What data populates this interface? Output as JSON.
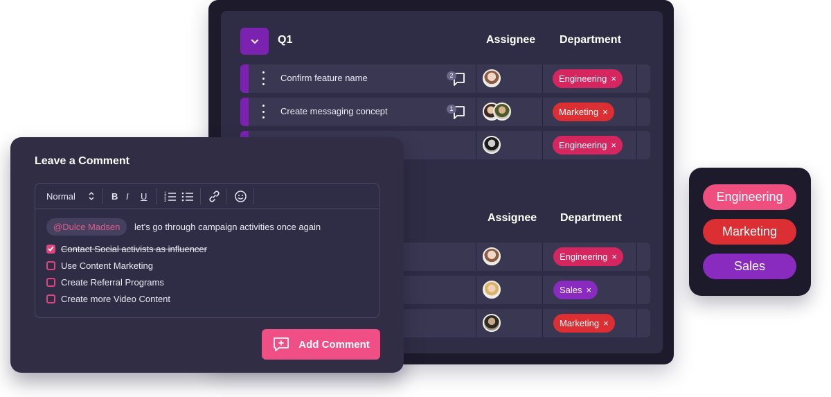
{
  "board": {
    "group1": {
      "title": "Q1",
      "assignee_label": "Assignee",
      "department_label": "Department",
      "rows": [
        {
          "task": "Confirm feature name",
          "comments": "2",
          "tag": "Engineering",
          "tag_close": "×"
        },
        {
          "task": "Create messaging concept",
          "comments": "1",
          "tag": "Marketing",
          "tag_close": "×"
        },
        {
          "task": "",
          "comments": "",
          "tag": "Engineering",
          "tag_close": "×"
        }
      ]
    },
    "group2": {
      "assignee_label": "Assignee",
      "department_label": "Department",
      "rows": [
        {
          "tag": "Engineering",
          "tag_close": "×"
        },
        {
          "tag": "Sales",
          "tag_close": "×"
        },
        {
          "tag": "Marketing",
          "tag_close": "×"
        }
      ]
    }
  },
  "comment": {
    "title": "Leave a Comment",
    "toolbar": {
      "style": "Normal",
      "bold": "B",
      "italic": "I",
      "underline": "U"
    },
    "mention": "@Dulce Madsen",
    "message": "let's go through campaign activities once again",
    "checklist": [
      {
        "label": "Contact Social activists as influencer",
        "checked": true
      },
      {
        "label": "Use Content Marketing",
        "checked": false
      },
      {
        "label": "Create Referral Programs",
        "checked": false
      },
      {
        "label": "Create more Video Content",
        "checked": false
      }
    ],
    "submit_label": "Add Comment"
  },
  "palette": {
    "options": [
      "Engineering",
      "Marketing",
      "Sales"
    ]
  },
  "colors": {
    "engineering": "#d6265f",
    "marketing": "#db2f33",
    "sales": "#8a2bbf",
    "accent_purple": "#7b23b0",
    "button_pink": "#ef4f84"
  }
}
